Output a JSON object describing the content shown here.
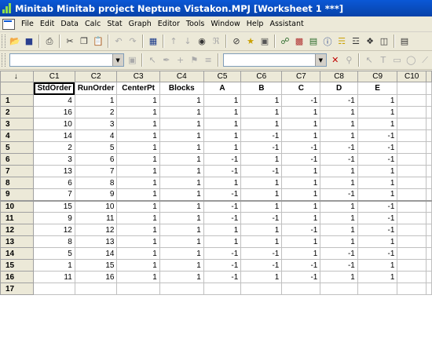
{
  "window": {
    "title": "Minitab  Minitab project Neptune Vistakon.MPJ  [Worksheet 1 ***]"
  },
  "menu": [
    "File",
    "Edit",
    "Data",
    "Calc",
    "Stat",
    "Graph",
    "Editor",
    "Tools",
    "Window",
    "Help",
    "Assistant"
  ],
  "columns": [
    {
      "id": "C1",
      "name": "StdOrder"
    },
    {
      "id": "C2",
      "name": "RunOrder"
    },
    {
      "id": "C3",
      "name": "CenterPt"
    },
    {
      "id": "C4",
      "name": "Blocks"
    },
    {
      "id": "C5",
      "name": "A"
    },
    {
      "id": "C6",
      "name": "B"
    },
    {
      "id": "C7",
      "name": "C"
    },
    {
      "id": "C8",
      "name": "D"
    },
    {
      "id": "C9",
      "name": "E"
    },
    {
      "id": "C10",
      "name": ""
    }
  ],
  "arrow_header": "↓",
  "rows": [
    {
      "n": "1",
      "cells": [
        "4",
        "1",
        "1",
        "1",
        "1",
        "1",
        "-1",
        "-1",
        "1"
      ]
    },
    {
      "n": "2",
      "cells": [
        "16",
        "2",
        "1",
        "1",
        "1",
        "1",
        "1",
        "1",
        "1"
      ]
    },
    {
      "n": "3",
      "cells": [
        "10",
        "3",
        "1",
        "1",
        "1",
        "1",
        "1",
        "1",
        "1"
      ]
    },
    {
      "n": "4",
      "cells": [
        "14",
        "4",
        "1",
        "1",
        "1",
        "-1",
        "1",
        "1",
        "-1"
      ]
    },
    {
      "n": "5",
      "cells": [
        "2",
        "5",
        "1",
        "1",
        "1",
        "-1",
        "-1",
        "-1",
        "-1"
      ]
    },
    {
      "n": "6",
      "cells": [
        "3",
        "6",
        "1",
        "1",
        "-1",
        "1",
        "-1",
        "-1",
        "-1"
      ]
    },
    {
      "n": "7",
      "cells": [
        "13",
        "7",
        "1",
        "1",
        "-1",
        "-1",
        "1",
        "1",
        "1"
      ]
    },
    {
      "n": "8",
      "cells": [
        "6",
        "8",
        "1",
        "1",
        "1",
        "1",
        "1",
        "1",
        "1"
      ]
    },
    {
      "n": "9",
      "cells": [
        "7",
        "9",
        "1",
        "1",
        "-1",
        "1",
        "1",
        "-1",
        "1"
      ]
    },
    {
      "n": "10",
      "cells": [
        "15",
        "10",
        "1",
        "1",
        "-1",
        "1",
        "1",
        "1",
        "-1"
      ]
    },
    {
      "n": "11",
      "cells": [
        "9",
        "11",
        "1",
        "1",
        "-1",
        "-1",
        "1",
        "1",
        "-1"
      ]
    },
    {
      "n": "12",
      "cells": [
        "12",
        "12",
        "1",
        "1",
        "1",
        "1",
        "-1",
        "1",
        "-1"
      ]
    },
    {
      "n": "13",
      "cells": [
        "8",
        "13",
        "1",
        "1",
        "1",
        "1",
        "1",
        "1",
        "1"
      ]
    },
    {
      "n": "14",
      "cells": [
        "5",
        "14",
        "1",
        "1",
        "-1",
        "-1",
        "1",
        "-1",
        "-1"
      ]
    },
    {
      "n": "15",
      "cells": [
        "1",
        "15",
        "1",
        "1",
        "-1",
        "-1",
        "-1",
        "-1",
        "1"
      ]
    },
    {
      "n": "16",
      "cells": [
        "11",
        "16",
        "1",
        "1",
        "-1",
        "1",
        "-1",
        "1",
        "1"
      ]
    },
    {
      "n": "17",
      "cells": [
        "",
        "",
        "",
        "",
        "",
        "",
        "",
        "",
        ""
      ]
    }
  ]
}
